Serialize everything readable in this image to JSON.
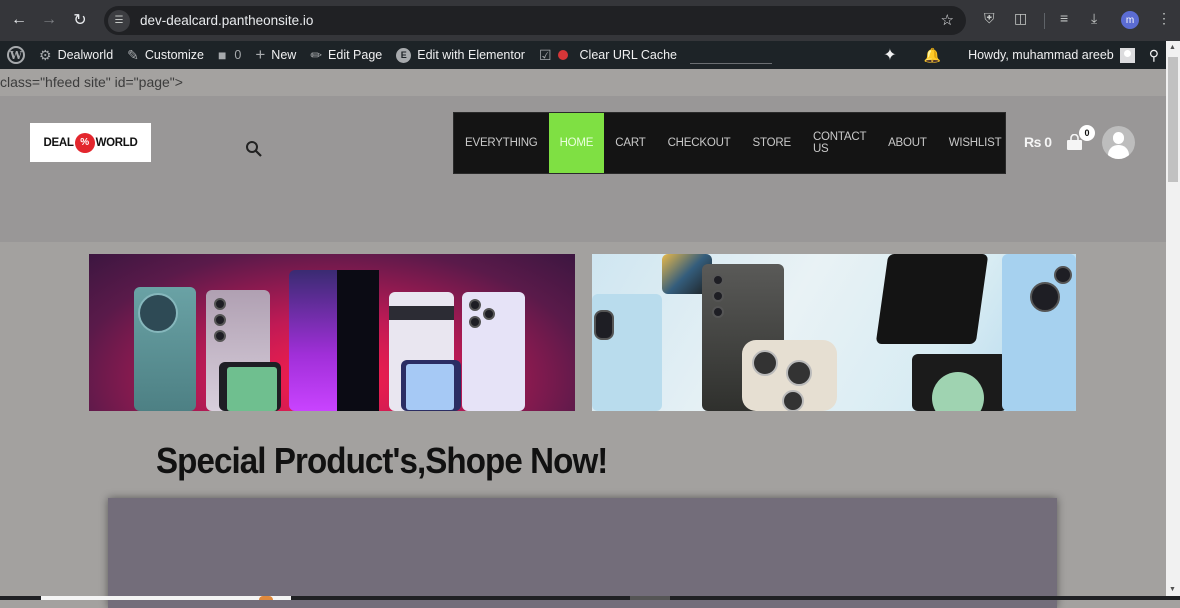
{
  "browser": {
    "url": "dev-dealcard.pantheonsite.io",
    "profile_initial": "m",
    "icons": [
      "back-icon",
      "forward-icon",
      "reload-icon",
      "site-info-icon",
      "bookmark-star-icon",
      "shield-extension-icon",
      "extensions-puzzle-icon",
      "media-queue-icon",
      "download-icon",
      "profile-avatar",
      "menu-kebab-icon"
    ]
  },
  "wp_admin_bar": {
    "site_name": "Dealworld",
    "customize": "Customize",
    "comments_count": "0",
    "new": "New",
    "edit_page": "Edit Page",
    "edit_elementor": "Edit with Elementor",
    "clear_cache": "Clear URL Cache",
    "howdy": "Howdy, muhammad areeb",
    "status_color": "#d63638"
  },
  "code_leak_text": "class=\"hfeed site\" id=\"page\">",
  "header": {
    "logo": {
      "left": "DEAL",
      "badge": "%",
      "right": "WORLD"
    },
    "menu": [
      {
        "label": "EVERYTHING",
        "active": false
      },
      {
        "label": "HOME",
        "active": true
      },
      {
        "label": "CART",
        "active": false
      },
      {
        "label": "CHECKOUT",
        "active": false
      },
      {
        "label": "STORE",
        "active": false
      },
      {
        "label": "CONTACT US",
        "active": false
      },
      {
        "label": "ABOUT",
        "active": false
      },
      {
        "label": "WISHLIST",
        "active": false
      }
    ],
    "cart_total": "Rs 0",
    "cart_count": "0",
    "accent_color": "#7fe043"
  },
  "banners": [
    {
      "name": "smartphones-lineup-banner"
    },
    {
      "name": "flagship-phones-banner"
    }
  ],
  "main": {
    "section_title": "Special Product's,Shope Now!"
  }
}
